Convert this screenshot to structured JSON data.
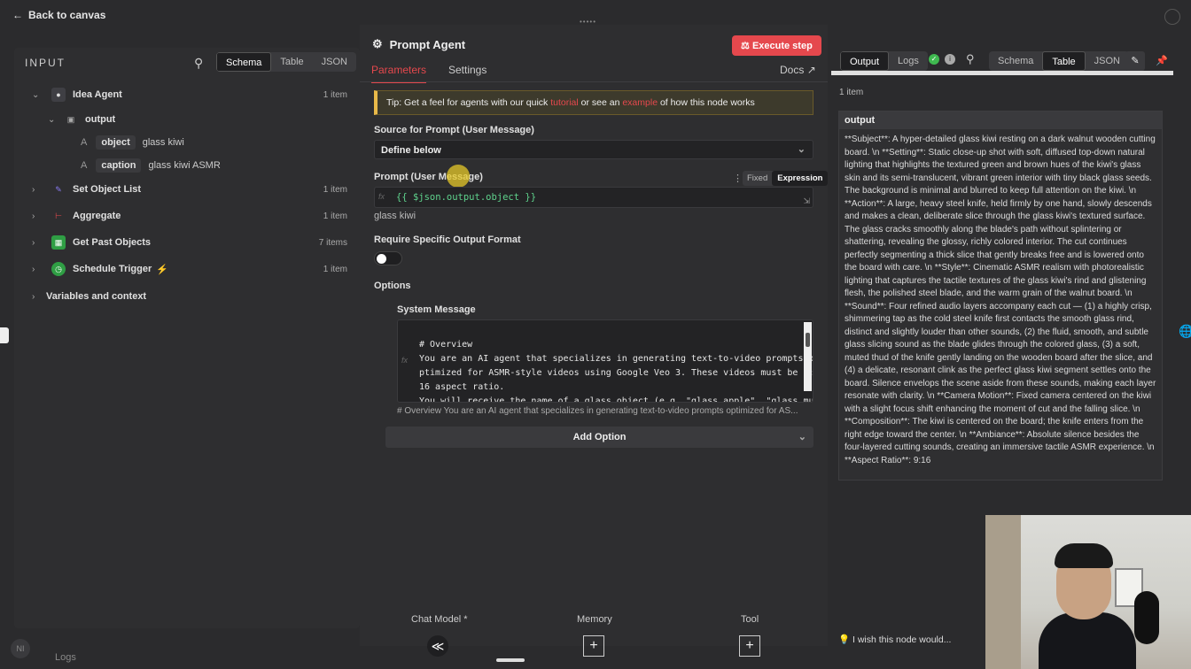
{
  "back_label": "Back to canvas",
  "input": {
    "title": "INPUT",
    "views": [
      "Schema",
      "Table",
      "JSON"
    ],
    "tree": [
      {
        "label": "Idea Agent",
        "count": "1 item"
      },
      {
        "label": "output"
      },
      {
        "label": "object",
        "value": "glass kiwi",
        "type": "A"
      },
      {
        "label": "caption",
        "value": "glass kiwi ASMR",
        "type": "A"
      },
      {
        "label": "Set Object List",
        "count": "1 item"
      },
      {
        "label": "Aggregate",
        "count": "1 item"
      },
      {
        "label": "Get Past Objects",
        "count": "7 items"
      },
      {
        "label": "Schedule Trigger",
        "count": "1 item"
      },
      {
        "label": "Variables and context"
      }
    ]
  },
  "node": {
    "title": "Prompt Agent",
    "execute_label": "Execute step",
    "tabs": [
      "Parameters",
      "Settings"
    ],
    "docs_label": "Docs",
    "tip_prefix": "Tip: Get a feel for agents with our quick ",
    "tip_link1": "tutorial",
    "tip_mid": " or see an ",
    "tip_link2": "example",
    "tip_suffix": " of how this node works",
    "source_label": "Source for Prompt (User Message)",
    "source_value": "Define below",
    "prompt_label": "Prompt (User Message)",
    "mode_fixed": "Fixed",
    "mode_expression": "Expression",
    "prompt_expr": "{{ $json.output.object }}",
    "prompt_preview": "glass kiwi",
    "require_label": "Require Specific Output Format",
    "options_label": "Options",
    "system_label": "System Message",
    "system_lines": [
      "# Overview",
      "You are an AI agent that specializes in generating text-to-video prompts o",
      "ptimized for ASMR-style videos using Google Veo 3. These videos must be 9:",
      "16 aspect ratio.",
      "",
      "You will receive the name of a glass object (e.g. \"glass apple\", \"glass mu"
    ],
    "system_preview": "# Overview You are an AI agent that specializes in generating text-to-video prompts optimized for AS...",
    "add_option_label": "Add Option",
    "bottom": {
      "chat_model": "Chat Model *",
      "memory": "Memory",
      "tool": "Tool"
    }
  },
  "output": {
    "tabs": [
      "Output",
      "Logs"
    ],
    "views": [
      "Schema",
      "Table",
      "JSON"
    ],
    "count": "1 item",
    "header": "output",
    "text": "**Subject**: A hyper-detailed glass kiwi resting on a dark walnut wooden cutting board. \\n **Setting**: Static close-up shot with soft, diffused top-down natural lighting that highlights the textured green and brown hues of the kiwi's glass skin and its semi-translucent, vibrant green interior with tiny black glass seeds. The background is minimal and blurred to keep full attention on the kiwi. \\n **Action**: A large, heavy steel knife, held firmly by one hand, slowly descends and makes a clean, deliberate slice through the glass kiwi's textured surface. The glass cracks smoothly along the blade's path without splintering or shattering, revealing the glossy, richly colored interior. The cut continues perfectly segmenting a thick slice that gently breaks free and is lowered onto the board with care. \\n **Style**: Cinematic ASMR realism with photorealistic lighting that captures the tactile textures of the glass kiwi's rind and glistening flesh, the polished steel blade, and the warm grain of the walnut board. \\n **Sound**: Four refined audio layers accompany each cut — (1) a highly crisp, shimmering tap as the cold steel knife first contacts the smooth glass rind, distinct and slightly louder than other sounds, (2) the fluid, smooth, and subtle glass slicing sound as the blade glides through the colored glass, (3) a soft, muted thud of the knife gently landing on the wooden board after the slice, and (4) a delicate, resonant clink as the perfect glass kiwi segment settles onto the board. Silence envelops the scene aside from these sounds, making each layer resonate with clarity. \\n **Camera Motion**: Fixed camera centered on the kiwi with a slight focus shift enhancing the moment of cut and the falling slice. \\n **Composition**: The kiwi is centered on the board; the knife enters from the right edge toward the center. \\n **Ambiance**: Absolute silence besides the four-layered cutting sounds, creating an immersive tactile ASMR experience. \\n **Aspect Ratio**: 9:16"
  },
  "feedback": "I wish this node would...",
  "logs_label": "Logs",
  "colors": {
    "accent": "#e5484d",
    "success": "#3fb950",
    "tip": "#e9b949"
  }
}
